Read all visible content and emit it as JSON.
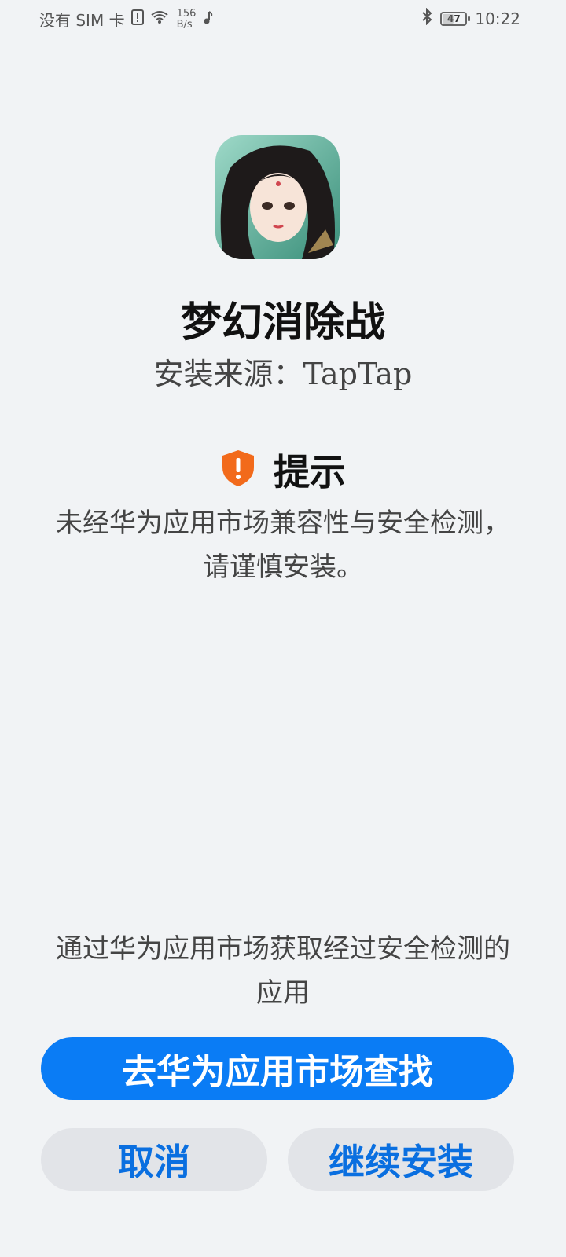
{
  "status_bar": {
    "sim_text": "没有 SIM 卡",
    "net_speed_value": "156",
    "net_speed_unit": "B/s",
    "battery": "47",
    "time": "10:22"
  },
  "app": {
    "name": "梦幻消除战",
    "install_source": "安装来源：TapTap"
  },
  "tip": {
    "title": "提示",
    "text": "未经华为应用市场兼容性与安全检测，请谨慎安装。"
  },
  "bottom_note": "通过华为应用市场获取经过安全检测的应用",
  "buttons": {
    "primary": "去华为应用市场查找",
    "cancel": "取消",
    "continue": "继续安装"
  },
  "colors": {
    "primary": "#0a7cf5",
    "warning": "#f26a1b",
    "background": "#f1f3f5"
  }
}
